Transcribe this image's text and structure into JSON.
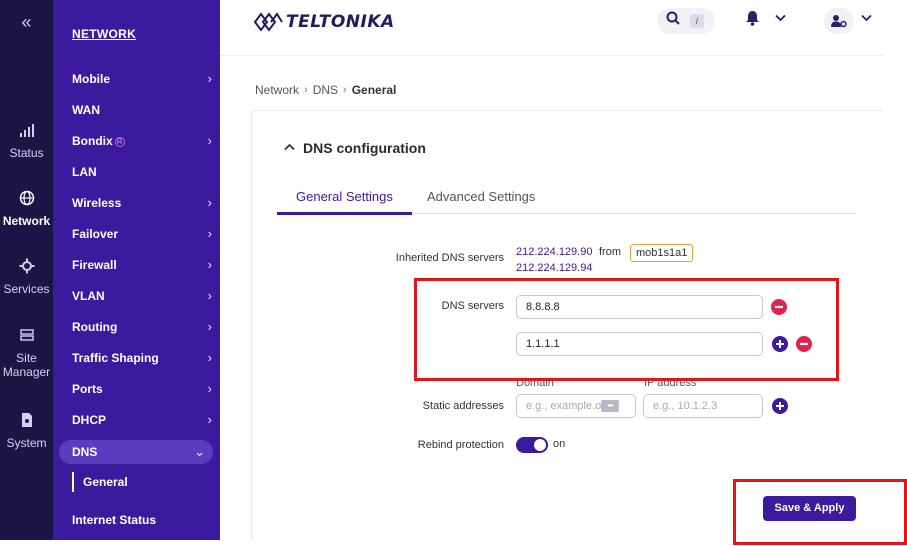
{
  "rail": {
    "collapse_glyph": "«",
    "items": [
      {
        "label": "Status",
        "icon": "signal-icon",
        "glyph": "📶"
      },
      {
        "label": "Network",
        "icon": "globe-icon",
        "glyph": "🌐",
        "active": true
      },
      {
        "label": "Services",
        "icon": "gear-icon",
        "glyph": "⚙"
      },
      {
        "label": "Site Manager",
        "icon": "site-manager-icon",
        "glyph": "🖧"
      },
      {
        "label": "System",
        "icon": "system-icon",
        "glyph": "🗎"
      }
    ]
  },
  "nav": {
    "title": "NETWORK",
    "items": [
      {
        "label": "Mobile",
        "chevron": "›"
      },
      {
        "label": "WAN",
        "chevron": ""
      },
      {
        "label": "Bondix",
        "chevron": "›"
      },
      {
        "label": "LAN",
        "chevron": ""
      },
      {
        "label": "Wireless",
        "chevron": "›"
      },
      {
        "label": "Failover",
        "chevron": "›"
      },
      {
        "label": "Firewall",
        "chevron": "›"
      },
      {
        "label": "VLAN",
        "chevron": "›"
      },
      {
        "label": "Routing",
        "chevron": "›"
      },
      {
        "label": "Traffic Shaping",
        "chevron": "›"
      },
      {
        "label": "Ports",
        "chevron": "›"
      },
      {
        "label": "DHCP",
        "chevron": "›"
      },
      {
        "label": "DNS",
        "chevron": "⌄"
      }
    ],
    "bondix_mark": "R",
    "sub_active": "General",
    "after_sub": "Internet Status"
  },
  "header": {
    "logo_text": "TELTONIKA",
    "search_shortcut": "/",
    "icons": [
      "search-icon",
      "bell-icon",
      "user-settings-icon"
    ]
  },
  "breadcrumb": [
    "Network",
    "DNS",
    "General"
  ],
  "section": {
    "title": "DNS configuration",
    "tabs": [
      "General Settings",
      "Advanced Settings"
    ],
    "active_tab": "General Settings"
  },
  "form": {
    "inherited_label": "Inherited DNS servers",
    "inherited_servers": [
      "212.224.129.90",
      "212.224.129.94"
    ],
    "from_text": "from",
    "interface": "mob1s1a1",
    "dns_label": "DNS servers",
    "dns_servers": [
      "8.8.8.8",
      "1.1.1.1"
    ],
    "static_label": "Static addresses",
    "domain_label": "Domain",
    "ip_label": "IP address",
    "domain_placeholder": "e.g., example.o",
    "ip_placeholder": "e.g., 10.1.2.3",
    "rebind_label": "Rebind protection",
    "rebind_state": "on"
  },
  "actions": {
    "save_label": "Save & Apply"
  },
  "colors": {
    "rail_bg": "#1c1646",
    "nav_bg": "#3b1a9e",
    "accent": "#3b1a9e",
    "danger": "#e0224f",
    "highlight_box": "#e3141b"
  }
}
